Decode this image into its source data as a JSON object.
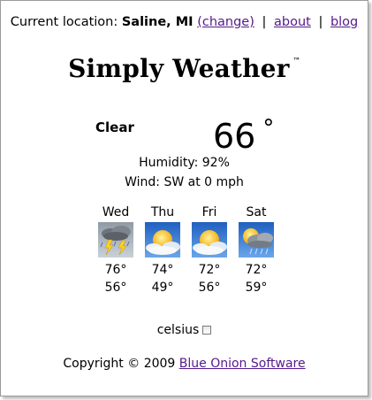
{
  "header": {
    "location_label": "Current location:",
    "location_value": "Saline, MI",
    "change_link": "(change)",
    "separator": "|",
    "about_link": "about",
    "blog_link": "blog"
  },
  "title": {
    "text": "Simply Weather",
    "trademark": "™"
  },
  "current": {
    "condition": "Clear",
    "temperature": "66",
    "degree": "°",
    "humidity": "Humidity: 92%",
    "wind": "Wind: SW at 0 mph"
  },
  "forecast": [
    {
      "day": "Wed",
      "icon": "thunderstorm-icon",
      "high": "76°",
      "low": "56°"
    },
    {
      "day": "Thu",
      "icon": "partly-sunny-icon",
      "high": "74°",
      "low": "49°"
    },
    {
      "day": "Fri",
      "icon": "partly-sunny-icon",
      "high": "72°",
      "low": "56°"
    },
    {
      "day": "Sat",
      "icon": "rain-sun-icon",
      "high": "72°",
      "low": "59°"
    }
  ],
  "settings": {
    "celsius_label": "celsius",
    "celsius_checked": false
  },
  "footer": {
    "copyright": "Copyright © 2009",
    "company_link": "Blue Onion Software"
  },
  "colors": {
    "link": "#551a8b",
    "sky_blue": "#3a7fd0",
    "sun": "#ffc21a"
  }
}
